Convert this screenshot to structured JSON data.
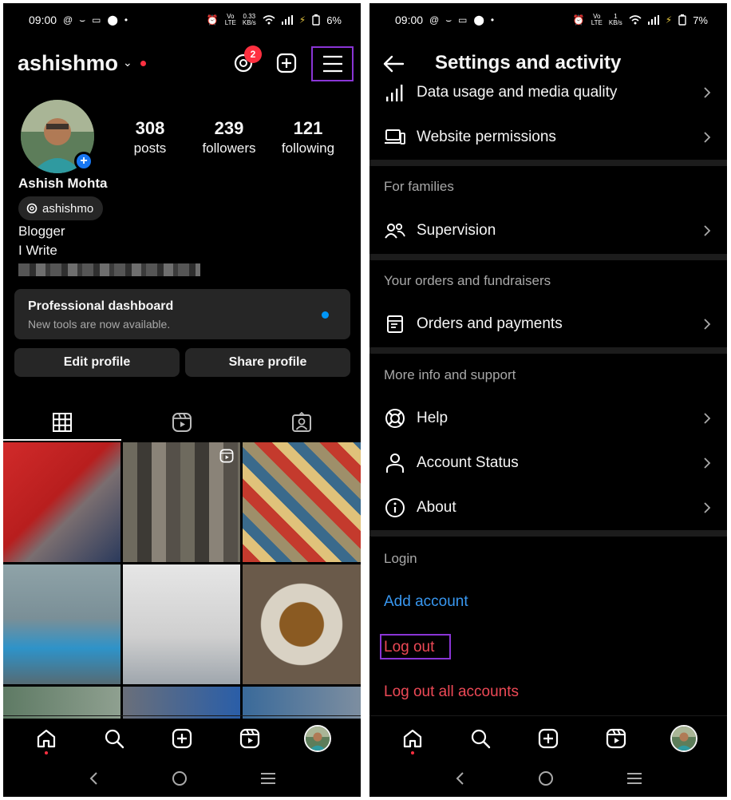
{
  "left": {
    "status": {
      "time": "09:00",
      "battery": "6%"
    },
    "profile": {
      "username": "ashishmo",
      "notification_count": "2",
      "stats": [
        {
          "num": "308",
          "label": "posts"
        },
        {
          "num": "239",
          "label": "followers"
        },
        {
          "num": "121",
          "label": "following"
        }
      ],
      "full_name": "Ashish Mohta",
      "threads_handle": "ashishmo",
      "bio": [
        "Blogger",
        "I Write"
      ]
    },
    "dashboard": {
      "title": "Professional dashboard",
      "subtitle": "New tools are now available."
    },
    "buttons": {
      "edit": "Edit profile",
      "share": "Share profile"
    }
  },
  "right": {
    "status": {
      "time": "09:00",
      "battery": "7%"
    },
    "title": "Settings and activity",
    "rows": {
      "data_usage": "Data usage and media quality",
      "website_permissions": "Website permissions",
      "supervision": "Supervision",
      "orders_payments": "Orders and payments",
      "help": "Help",
      "account_status": "Account Status",
      "about": "About"
    },
    "sections": {
      "families": "For families",
      "orders": "Your orders and fundraisers",
      "support": "More info and support",
      "login": "Login"
    },
    "login": {
      "add_account": "Add account",
      "log_out": "Log out",
      "log_out_all": "Log out all accounts"
    },
    "colors": {
      "link_blue": "#3897f0",
      "danger_red": "#ed4956",
      "highlight_purple": "#8a35d6"
    }
  }
}
